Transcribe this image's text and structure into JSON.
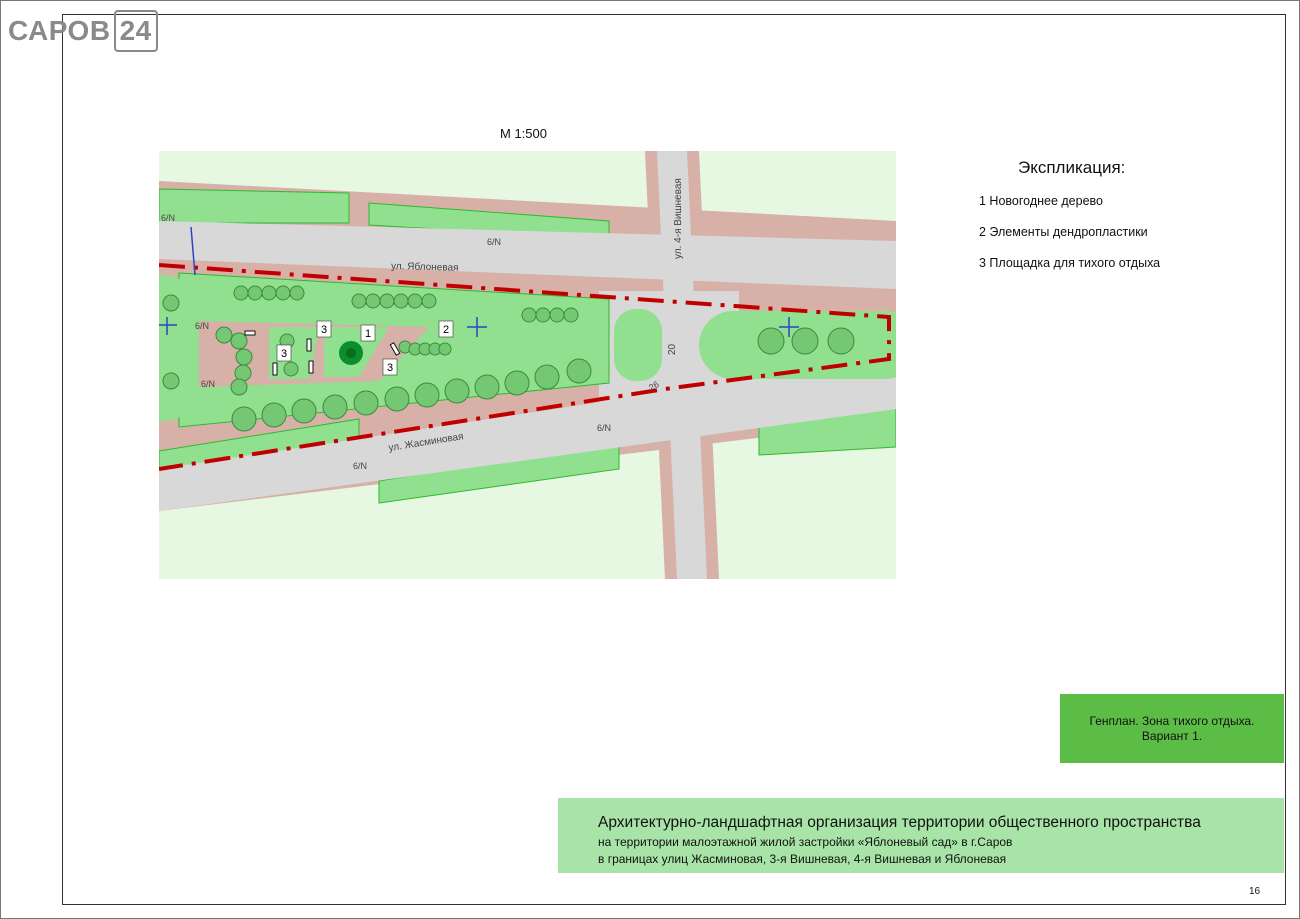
{
  "logo": {
    "text_left": "САРОВ",
    "text_box": "24"
  },
  "scale": "М 1:500",
  "map": {
    "streets": {
      "yablonevaya": "ул. Яблоневая",
      "jasminovaya": "ул. Жасминовая",
      "vishnevaya4": "ул. 4-я Вишневая"
    },
    "dimension": "20",
    "dimension_2": "26",
    "utility_label": "6/N",
    "callouts": [
      "1",
      "2",
      "3"
    ]
  },
  "legend": {
    "title": "Экспликация:",
    "items": [
      "1  Новогоднее дерево",
      "2  Элементы дендропластики",
      "3 Площадка для тихого отдыха"
    ]
  },
  "sheet_title": {
    "line1": "Генплан. Зона тихого отдыха.",
    "line2": "Вариант 1."
  },
  "project": {
    "main": "Архитектурно-ландшафтная организация территории общественного пространства",
    "line2": "на территории малоэтажной жилой застройки «Яблоневый сад» в г.Саров",
    "line3": "в границах улиц Жасминовая, 3-я Вишневая, 4-я Вишневая и Яблоневая"
  },
  "page_number": "16",
  "colors": {
    "lawn": "#90e090",
    "lawn_light": "#e6f7e2",
    "road": "#d8d8d8",
    "sidewalk": "#d7b1a8",
    "tree": "#74c874",
    "boundary": "#c00000",
    "title_green": "#5cbd46",
    "project_green": "#a8e4a8"
  }
}
